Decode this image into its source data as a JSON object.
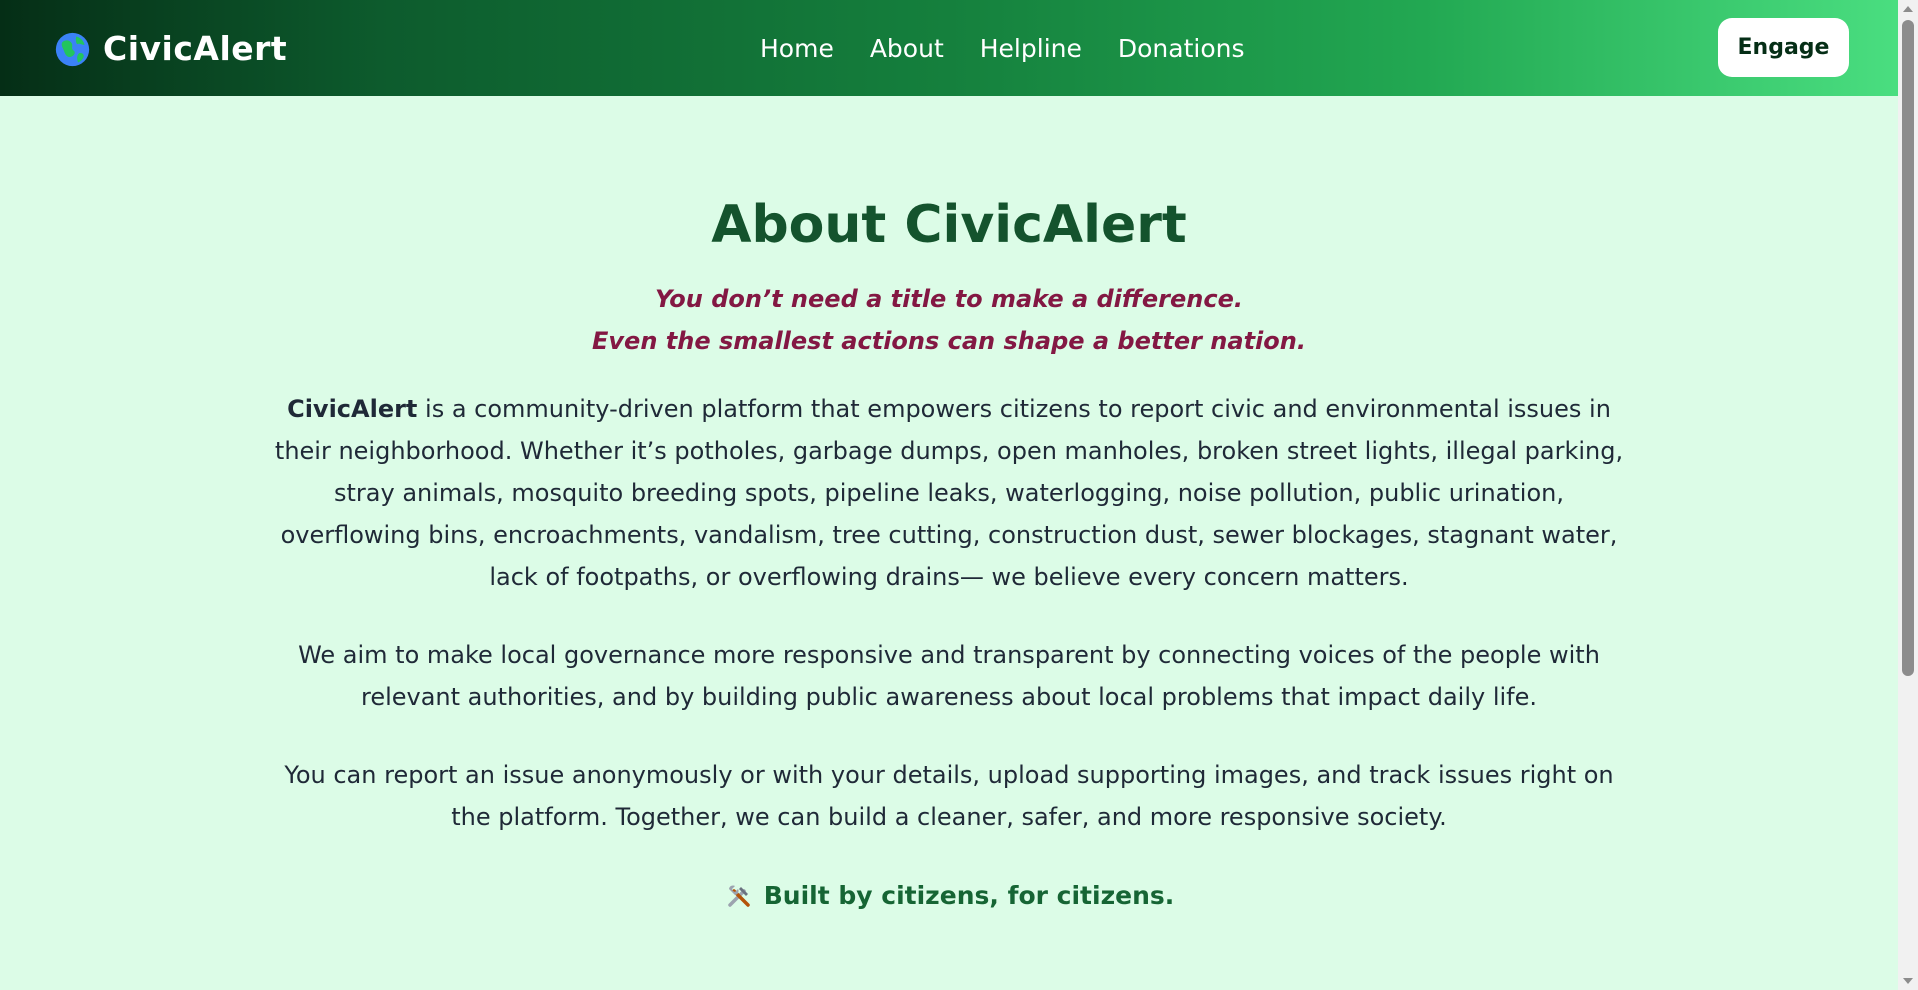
{
  "nav": {
    "brand": "CivicAlert",
    "brand_icon": "globe-icon",
    "links": [
      "Home",
      "About",
      "Helpline",
      "Donations"
    ],
    "cta": "Engage"
  },
  "main": {
    "title": "About CivicAlert",
    "tagline_1": "You don’t need a title to make a difference.",
    "tagline_2": "Even the smallest actions can shape a better nation.",
    "p1_brand": "CivicAlert",
    "p1_rest": " is a community-driven platform that empowers citizens to report civic and environmental issues in their neighborhood. Whether it’s potholes, garbage dumps, open manholes, broken street lights, illegal parking, stray animals, mosquito breeding spots, pipeline leaks, waterlogging, noise pollution, public urination, overflowing bins, encroachments, vandalism, tree cutting, construction dust, sewer blockages, stagnant water, lack of footpaths, or overflowing drains— we believe every concern matters.",
    "p2": "We aim to make local governance more responsive and transparent by connecting voices of the people with relevant authorities, and by building public awareness about local problems that impact daily life.",
    "p3": "You can report an issue anonymously or with your details, upload supporting images, and track issues right on the platform. Together, we can build a cleaner, safer, and more responsive society.",
    "footer_icon": "tools-icon",
    "footer": "Built by citizens, for citizens."
  },
  "colors": {
    "nav_gradient_start": "#052e16",
    "nav_gradient_end": "#4ade80",
    "background": "#dcfce7",
    "title": "#14532d",
    "tagline": "#831843",
    "body_text": "#1f2937",
    "footer_text": "#166534"
  }
}
